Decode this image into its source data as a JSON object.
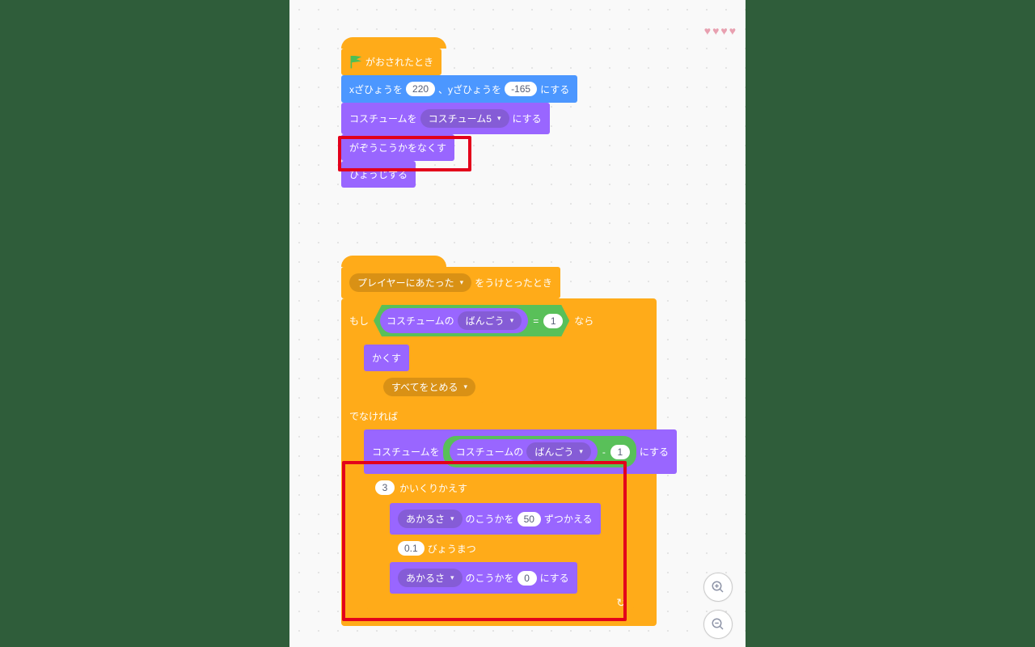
{
  "hearts_count": 4,
  "stack1": {
    "hat": "がおされたとき",
    "goto_pre": "xざひょうを",
    "goto_x": "220",
    "goto_mid": "、yざひょうを",
    "goto_y": "-165",
    "goto_post": "にする",
    "costume_pre": "コスチュームを",
    "costume_dd": "コスチューム5",
    "costume_post": "にする",
    "clear_effects": "がぞうこうかをなくす",
    "show": "ひょうじする"
  },
  "stack2": {
    "recv_dd": "プレイヤーにあたった",
    "recv_post": "をうけとったとき",
    "if_pre": "もし",
    "if_post": "なら",
    "costume_of_pre": "コスチュームの",
    "costume_of_dd": "ばんごう",
    "eq_val": "1",
    "hide": "かくす",
    "stop_dd": "すべてをとめる",
    "else": "でなければ",
    "switch_pre": "コスチュームを",
    "sub_b": "1",
    "switch_post": "にする",
    "repeat_n": "3",
    "repeat_post": "かいくりかえす",
    "effect1_dd": "あかるさ",
    "effect1_mid": "のこうかを",
    "effect1_val": "50",
    "effect1_post": "ずつかえる",
    "wait_n": "0.1",
    "wait_post": "びょうまつ",
    "effect2_dd": "あかるさ",
    "effect2_mid": "のこうかを",
    "effect2_val": "0",
    "effect2_post": "にする"
  },
  "zoom": {
    "in": "⊕",
    "out": "⊖"
  }
}
